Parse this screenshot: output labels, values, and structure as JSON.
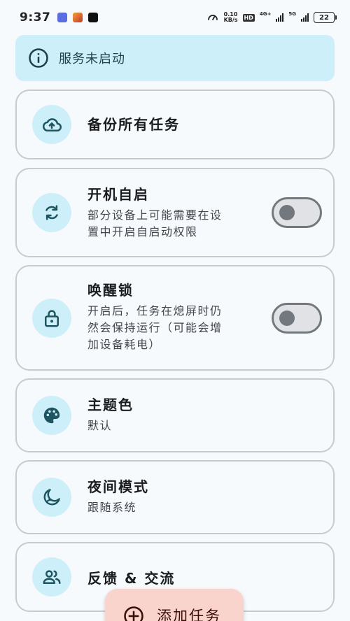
{
  "status_bar": {
    "time": "9:37",
    "speed_value": "0.10",
    "speed_unit": "KB/s",
    "hd_label": "HD",
    "net_4g": "4G+",
    "net_5g": "5G",
    "battery": "22"
  },
  "banner": {
    "icon": "info-icon",
    "text": "服务未启动"
  },
  "settings": {
    "backup": {
      "icon": "cloud-upload-icon",
      "title": "备份所有任务"
    },
    "autostart": {
      "icon": "refresh-icon",
      "title": "开机自启",
      "sub_line1": "部分设备上可能需要在设",
      "sub_line2": "置中开启自启动权限",
      "enabled": false
    },
    "wakelock": {
      "icon": "lock-icon",
      "title": "唤醒锁",
      "sub_line1": "开启后，任务在熄屏时仍",
      "sub_line2": "然会保持运行（可能会增",
      "sub_line3": "加设备耗电）",
      "enabled": false
    },
    "theme": {
      "icon": "palette-icon",
      "title": "主题色",
      "value": "默认"
    },
    "night": {
      "icon": "moon-icon",
      "title": "夜间模式",
      "value": "跟随系统"
    },
    "feedback": {
      "icon": "people-icon",
      "title": "反馈 & 交流"
    }
  },
  "fab": {
    "icon": "add-circle-icon",
    "label": "添加任务"
  },
  "colors": {
    "background": "#f7fafd",
    "banner_bg": "#cdeffa",
    "icon_fg": "#1d5560",
    "fab_bg": "#f8d4cc",
    "fab_fg": "#3b0d05"
  }
}
